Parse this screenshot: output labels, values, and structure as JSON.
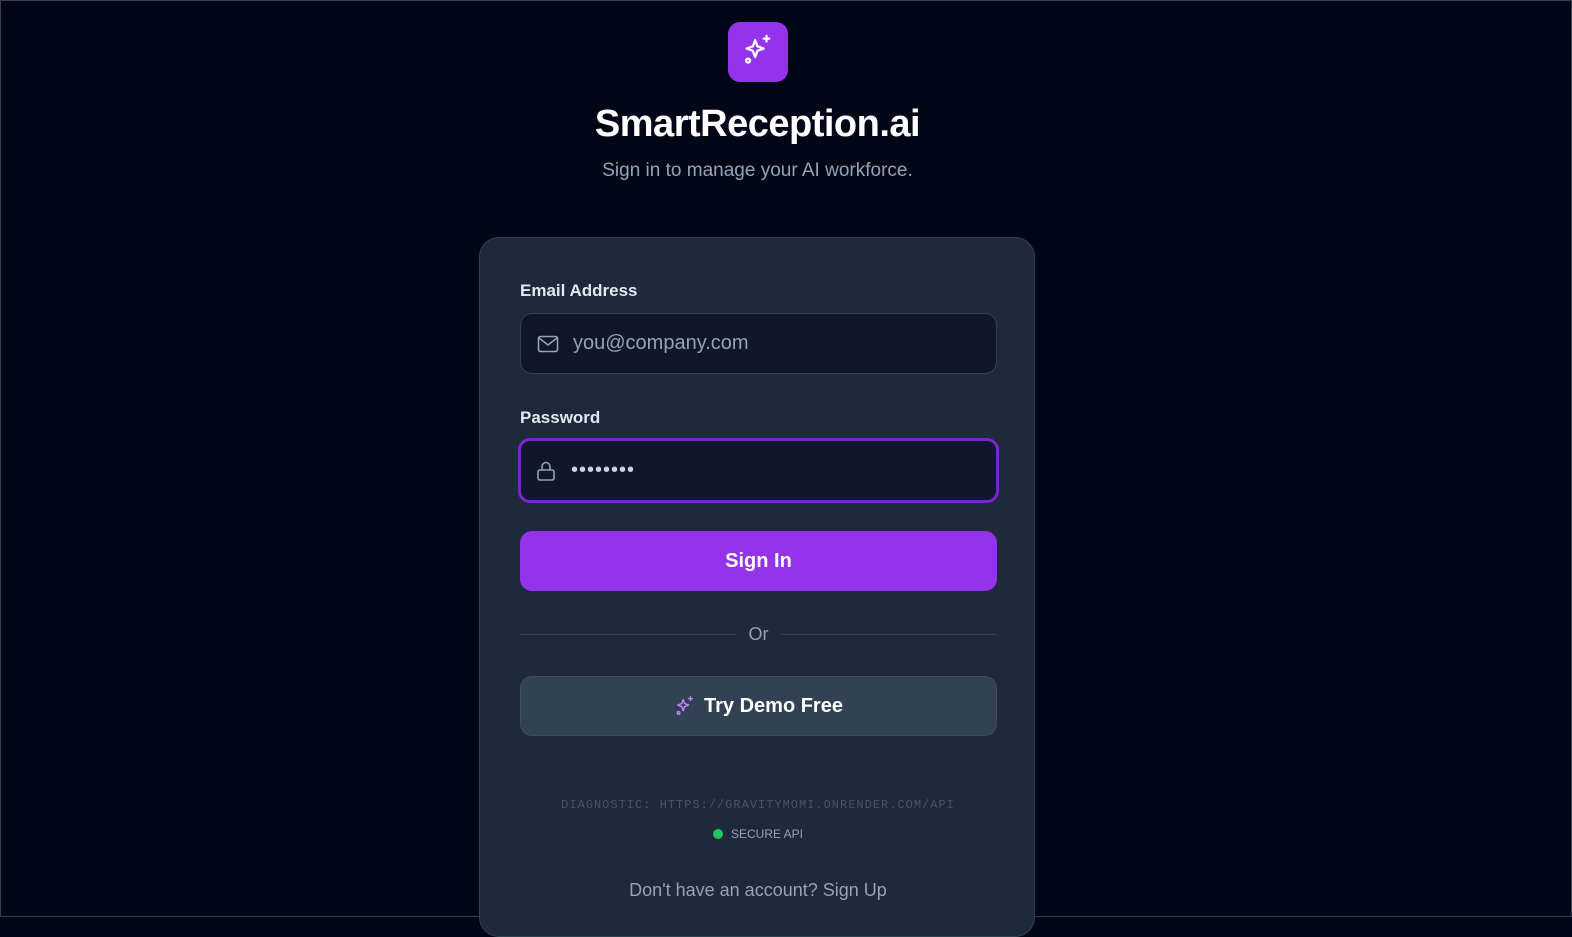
{
  "brand": {
    "logo_icon": "sparkles-icon",
    "title": "SmartReception.ai",
    "subtitle": "Sign in to manage your AI workforce."
  },
  "form": {
    "email": {
      "label": "Email Address",
      "icon": "mail-icon",
      "placeholder": "you@company.com",
      "value": ""
    },
    "password": {
      "label": "Password",
      "icon": "lock-icon",
      "value": "••••••••",
      "focused": true
    },
    "submit_label": "Sign In",
    "divider_text": "Or",
    "demo_label": "Try Demo Free",
    "demo_icon": "sparkles-icon"
  },
  "diagnostic": {
    "text": "DIAGNOSTIC: HTTPS://GRAVITYMOMI.ONRENDER.COM/API",
    "status_label": "SECURE API",
    "status_color": "#22c55e"
  },
  "footer": {
    "prompt": "Don't have an account?",
    "link_label": "Sign Up"
  },
  "colors": {
    "background": "#020617",
    "card": "#1e293b",
    "accent": "#9333ea",
    "focus_border": "#7e22ce",
    "secondary_button": "#334155"
  }
}
